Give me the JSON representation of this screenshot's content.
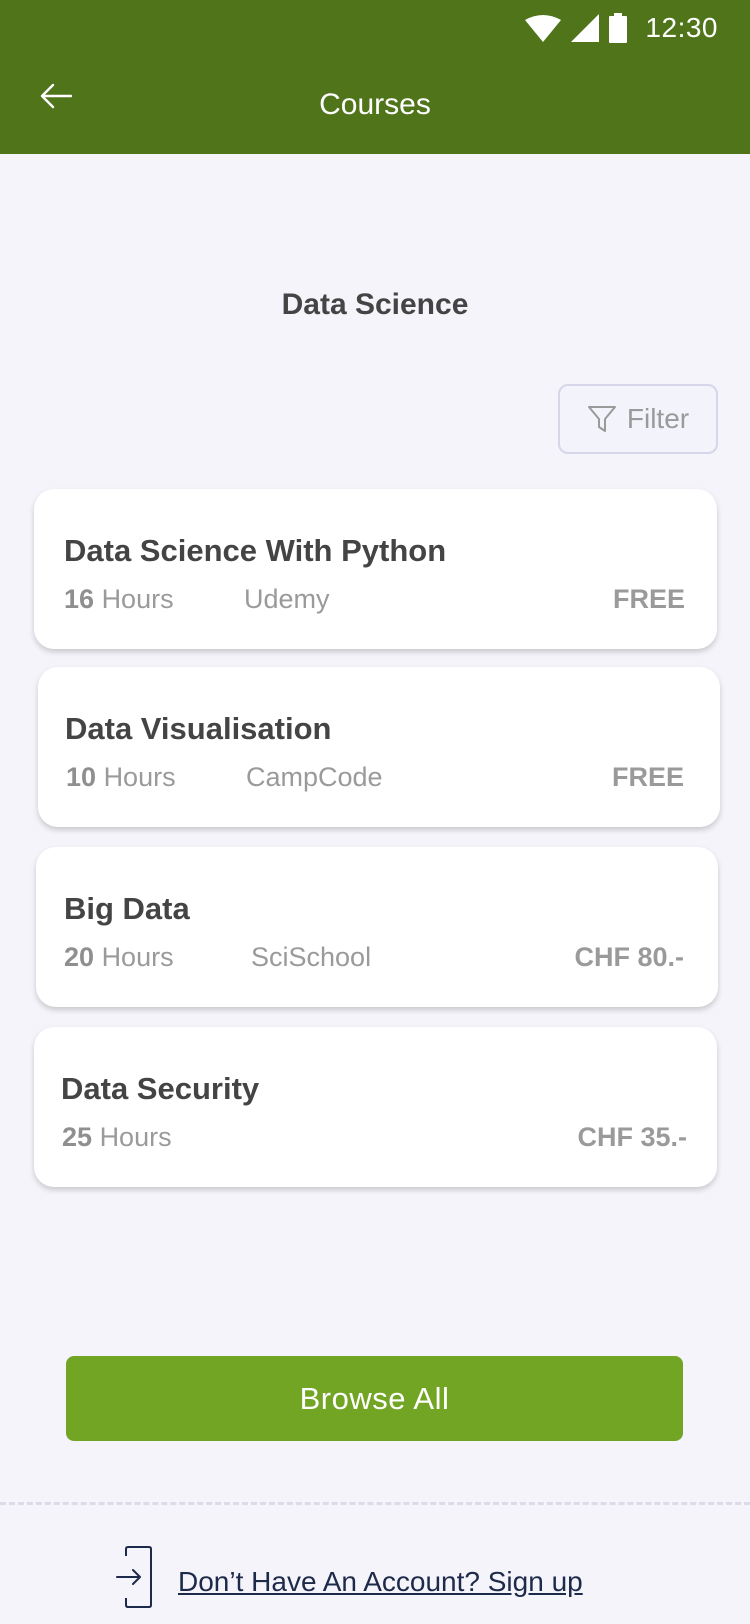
{
  "status_bar": {
    "time": "12:30",
    "icons": [
      "wifi-icon",
      "cell-signal-icon",
      "battery-icon"
    ]
  },
  "app_bar": {
    "title": "Courses",
    "back_icon": "arrow-left-icon"
  },
  "section": {
    "title": "Data Science"
  },
  "filter": {
    "label": "Filter",
    "icon": "filter-icon"
  },
  "courses": [
    {
      "name": "Data Science With Python",
      "hours_value": "16",
      "hours_unit": "Hours",
      "provider": "Udemy",
      "price": "FREE"
    },
    {
      "name": "Data Visualisation",
      "hours_value": "10",
      "hours_unit": "Hours",
      "provider": "CampCode",
      "price": "FREE"
    },
    {
      "name": "Big Data",
      "hours_value": "20",
      "hours_unit": "Hours",
      "provider": "SciSchool",
      "price": "CHF 80.-"
    },
    {
      "name": "Data Security",
      "hours_value": "25",
      "hours_unit": "Hours",
      "provider": "",
      "price": "CHF 35.-"
    }
  ],
  "browse_all": {
    "label": "Browse All"
  },
  "footer": {
    "signup_text": "Don’t Have An Account? Sign up",
    "icon": "sign-in-icon"
  },
  "colors": {
    "app_bar": "#4f7419",
    "primary_button": "#72a524",
    "background": "#f4f4fa"
  }
}
